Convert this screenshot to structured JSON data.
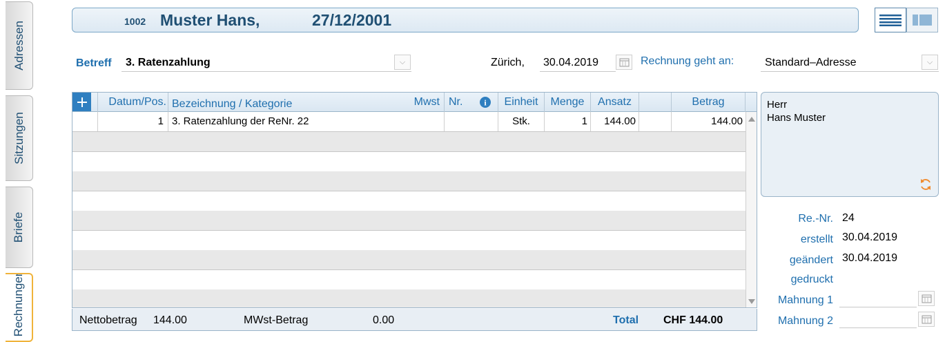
{
  "sidebar": {
    "tabs": [
      {
        "label": "Adressen"
      },
      {
        "label": "Sitzungen"
      },
      {
        "label": "Briefe"
      },
      {
        "label": "Rechnungen"
      }
    ]
  },
  "header": {
    "patient_id": "1002",
    "patient_name": "Muster Hans,",
    "birth_date": "27/12/2001"
  },
  "form": {
    "betreff_label": "Betreff",
    "betreff_value": "3. Ratenzahlung",
    "place": "Zürich,",
    "date": "30.04.2019",
    "recipient_label": "Rechnung geht an:",
    "recipient_value": "Standard–Adresse"
  },
  "table": {
    "add_icon": "plus-icon",
    "headers": {
      "datum": "Datum/Pos.",
      "bezeichnung": "Bezeichnung / Kategorie",
      "mwst": "Mwst",
      "nr": "Nr.",
      "einheit": "Einheit",
      "menge": "Menge",
      "ansatz": "Ansatz",
      "betrag": "Betrag"
    },
    "rows": [
      {
        "pos": "1",
        "bezeichnung": "3. Ratenzahlung der ReNr. 22",
        "mwst": "",
        "nr": "",
        "einheit": "Stk.",
        "menge": "1",
        "ansatz": "144.00",
        "betrag": "144.00"
      }
    ]
  },
  "footer": {
    "netto_label": "Nettobetrag",
    "netto_value": "144.00",
    "mwst_label": "MWst-Betrag",
    "mwst_value": "0.00",
    "total_label": "Total",
    "total_value": "CHF 144.00"
  },
  "address": {
    "line1": "Herr",
    "line2": "Hans Muster"
  },
  "meta": {
    "renr_label": "Re.-Nr.",
    "renr_value": "24",
    "erstellt_label": "erstellt",
    "erstellt_value": "30.04.2019",
    "geaendert_label": "geändert",
    "geaendert_value": "30.04.2019",
    "gedruckt_label": "gedruckt",
    "mahnung1_label": "Mahnung 1",
    "mahnung2_label": "Mahnung 2"
  },
  "colors": {
    "accent_blue": "#1f6fae",
    "header_blue": "#1f4f73",
    "active_tab_border": "#f0b33a",
    "refresh_icon": "#f08a2c"
  }
}
